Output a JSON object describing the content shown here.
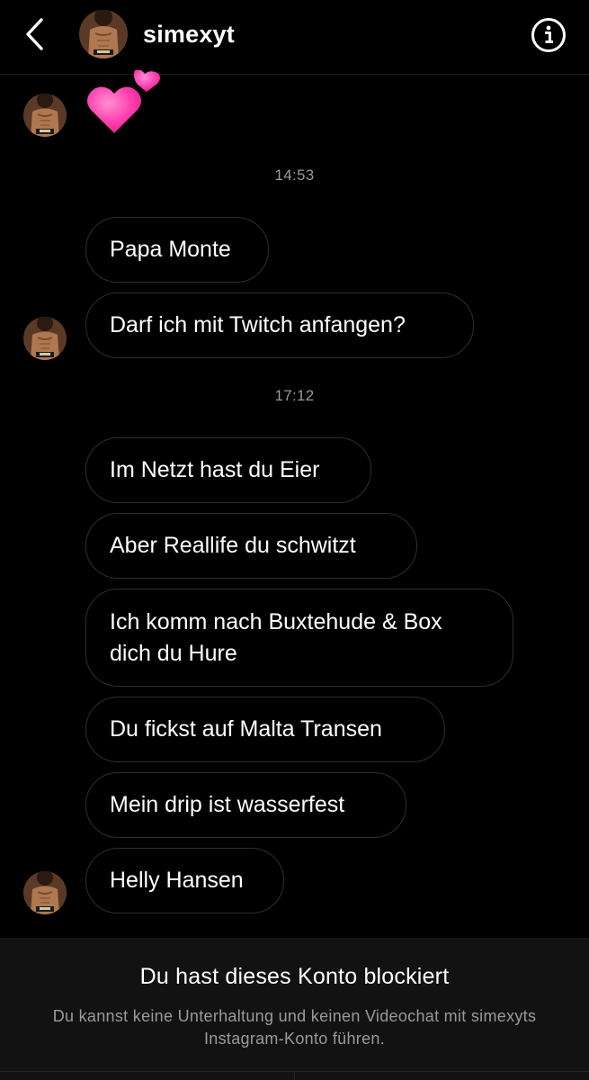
{
  "header": {
    "username": "simexyt",
    "back_icon": "chevron-left-icon",
    "info_icon": "info-circle-icon"
  },
  "chat": {
    "reaction_emoji": "pink-hearts-emoji",
    "groups": [
      {
        "timestamp": "14:53",
        "messages": [
          "Papa Monte",
          "Darf ich mit Twitch anfangen?"
        ]
      },
      {
        "timestamp": "17:12",
        "messages": [
          "Im Netzt hast du Eier",
          "Aber Reallife du schwitzt",
          "Ich komm nach Buxtehude & Box dich du Hure",
          "Du fickst auf Malta Transen",
          "Mein drip ist wasserfest",
          "Helly Hansen"
        ]
      }
    ]
  },
  "footer": {
    "title": "Du hast dieses Konto blockiert",
    "description": "Du kannst keine Unterhaltung und keinen Videochat mit simexyts Instagram-Konto führen."
  },
  "colors": {
    "background": "#000000",
    "bubble_border": "#2f2f2f",
    "timestamp": "#9a9a9a",
    "footer_bg": "#121212",
    "heart_pink": "#ff4fb6"
  }
}
